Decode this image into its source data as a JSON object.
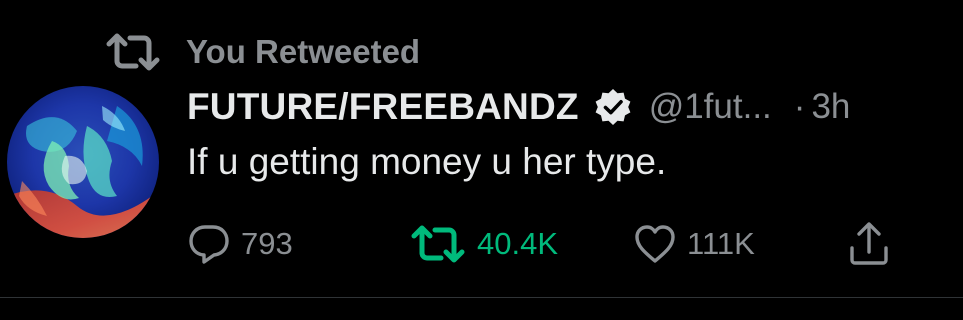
{
  "retweet_context": {
    "label": "You Retweeted",
    "icon": "retweet-icon"
  },
  "author": {
    "display_name": "FUTURE/FREEBANDZ",
    "verified": true,
    "handle": "@1fut...",
    "separator": "·",
    "timestamp": "3h"
  },
  "tweet": {
    "text": "If u getting money u her type."
  },
  "actions": {
    "reply_count": "793",
    "retweet_count": "40.4K",
    "like_count": "111K"
  },
  "colors": {
    "background": "#000000",
    "primary_text": "#e7e9ea",
    "secondary_text": "#8b8f93",
    "retweet_active": "#00ba7c",
    "divider": "#2f3336"
  }
}
